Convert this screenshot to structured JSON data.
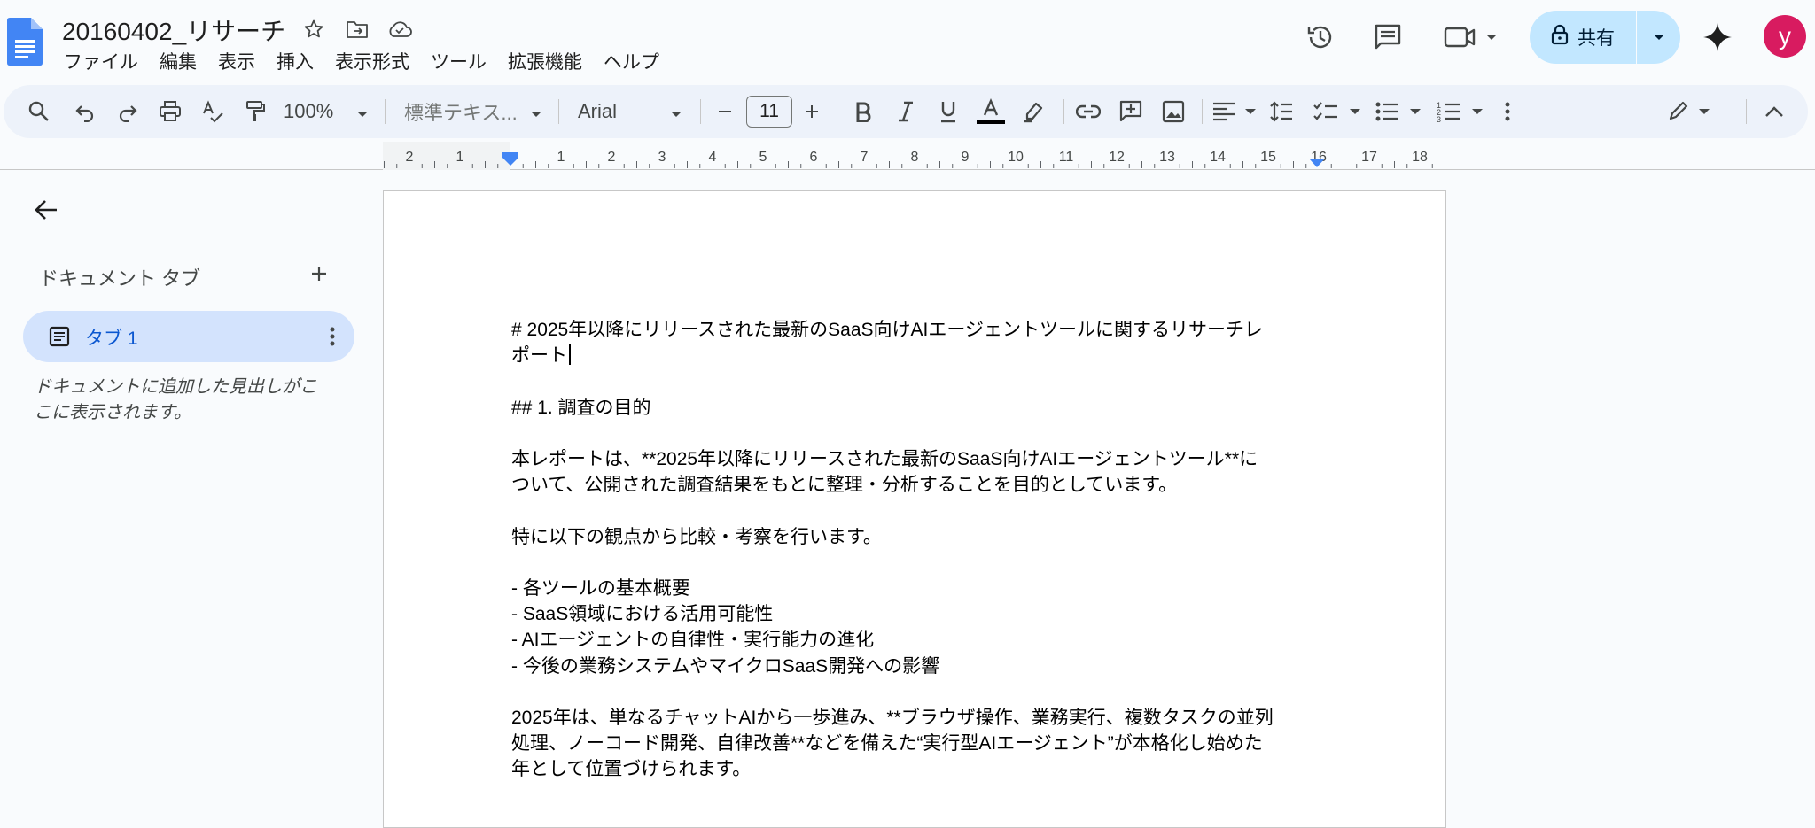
{
  "header": {
    "doc_title": "20160402_リサーチ",
    "menu": [
      "ファイル",
      "編集",
      "表示",
      "挿入",
      "表示形式",
      "ツール",
      "拡張機能",
      "ヘルプ"
    ],
    "share_label": "共有",
    "avatar_letter": "y"
  },
  "toolbar": {
    "zoom": "100%",
    "style": "標準テキス...",
    "font": "Arial",
    "font_size": "11"
  },
  "ruler": {
    "left_labels": [
      "2",
      "1"
    ],
    "right_labels": [
      "1",
      "2",
      "3",
      "4",
      "5",
      "6",
      "7",
      "8",
      "9",
      "10",
      "11",
      "12",
      "13",
      "14",
      "15",
      "16",
      "17",
      "18"
    ]
  },
  "sidebar": {
    "heading": "ドキュメント タブ",
    "tab_label": "タブ 1",
    "hint": "ドキュメントに追加した見出しがここに表示されます。"
  },
  "document": {
    "title_line1": "# 2025年以降にリリースされた最新のSaaS向けAIエージェントツールに関するリサーチレ",
    "title_line2": "ポート",
    "section_heading": "## 1. 調査の目的",
    "para1_line1": "本レポートは、**2025年以降にリリースされた最新のSaaS向けAIエージェントツール**に",
    "para1_line2": "ついて、公開された調査結果をもとに整理・分析することを目的としています。",
    "para2": "特に以下の観点から比較・考察を行います。",
    "bullets": [
      "- 各ツールの基本概要",
      "- SaaS領域における活用可能性",
      "- AIエージェントの自律性・実行能力の進化",
      "- 今後の業務システムやマイクロSaaS開発への影響"
    ],
    "para3_line1": "2025年は、単なるチャットAIから一歩進み、**ブラウザ操作、業務実行、複数タスクの並列",
    "para3_line2": "処理、ノーコード開発、自律改善**などを備えた“実行型AIエージェント”が本格化し始めた",
    "para3_line3": "年として位置づけられます。"
  },
  "colors": {
    "accent": "#0b57d0",
    "share_bg": "#c2e7ff",
    "tab_active_bg": "#d3e3fd",
    "toolbar_bg": "#edf2fa",
    "avatar_bg": "#d81b60",
    "doc_icon": "#4285f4"
  }
}
